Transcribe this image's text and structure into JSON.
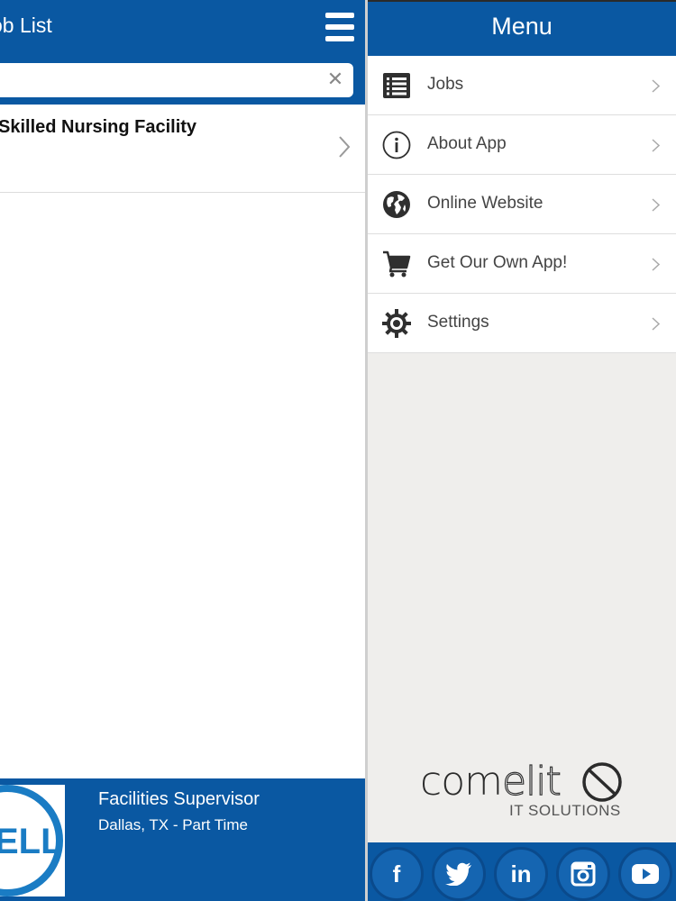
{
  "left": {
    "title": "ob List",
    "search": {
      "value": "",
      "placeholder": ""
    },
    "jobs": [
      {
        "title": "Skilled Nursing Facility"
      }
    ],
    "ad": {
      "title": "Facilities Supervisor",
      "subtitle": "Dallas, TX - Part Time"
    }
  },
  "menu": {
    "title": "Menu",
    "items": [
      {
        "label": "Jobs",
        "icon": "list-icon"
      },
      {
        "label": "About App",
        "icon": "info-icon"
      },
      {
        "label": "Online Website",
        "icon": "globe-icon"
      },
      {
        "label": "Get Our Own App!",
        "icon": "cart-icon"
      },
      {
        "label": "Settings",
        "icon": "gear-icon"
      }
    ]
  },
  "brand": {
    "name_prefix": "com",
    "name_highlight": "elit",
    "tagline": "IT SOLUTIONS"
  },
  "social": [
    {
      "glyph": "f",
      "icon": "facebook-icon"
    },
    {
      "glyph": "",
      "icon": "twitter-icon"
    },
    {
      "glyph": "in",
      "icon": "linkedin-icon"
    },
    {
      "glyph": "",
      "icon": "instagram-icon"
    },
    {
      "glyph": "",
      "icon": "youtube-icon"
    }
  ],
  "colors": {
    "primary": "#0a58a2",
    "menu_background": "#efeeec"
  }
}
